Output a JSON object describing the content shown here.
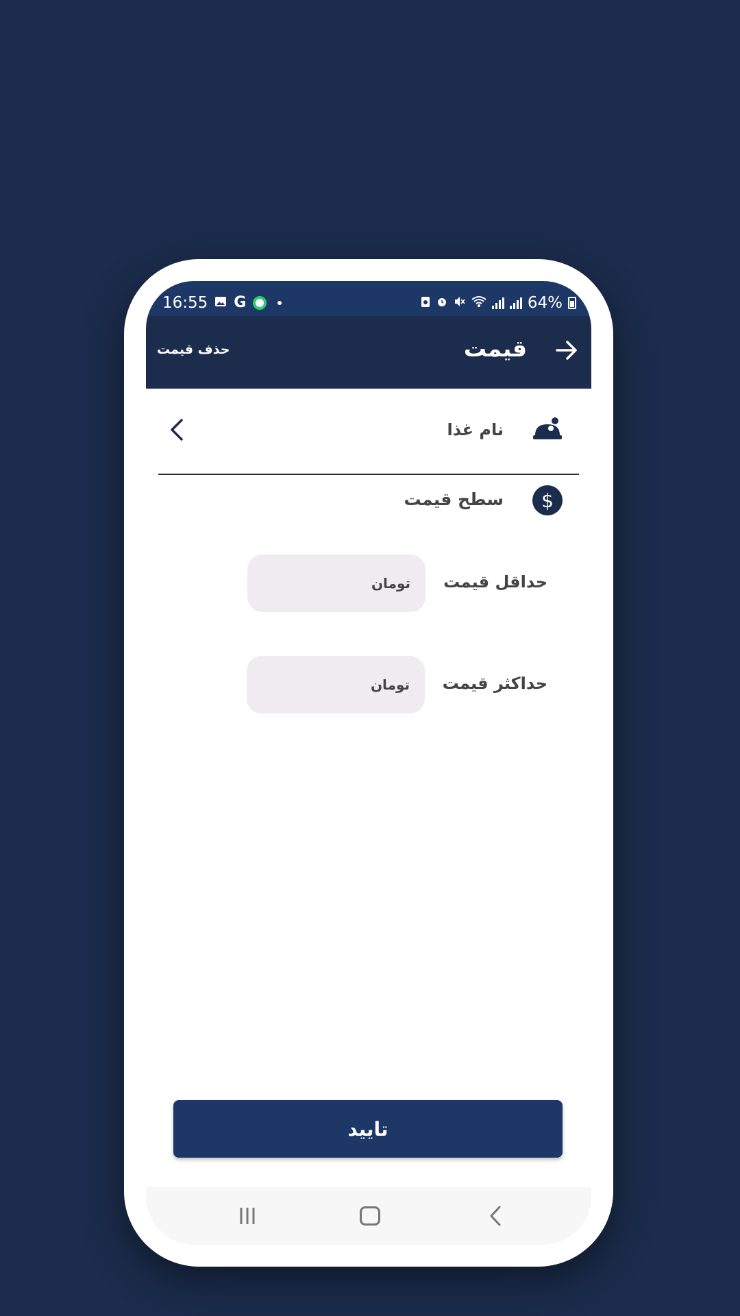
{
  "status_bar": {
    "time": "16:55",
    "g_label": "G",
    "battery": "64%"
  },
  "app_bar": {
    "title": "قیمت",
    "delete_label": "حذف قیمت"
  },
  "food_row": {
    "label": "نام غذا"
  },
  "price_level": {
    "label": "سطح قیمت",
    "icon_glyph": "$"
  },
  "min_price": {
    "label": "حداقل قیمت",
    "unit": "تومان"
  },
  "max_price": {
    "label": "حداکثر قیمت",
    "unit": "تومان"
  },
  "confirm": {
    "label": "تایید"
  },
  "colors": {
    "background": "#1b2c4c",
    "app_bar": "#1b2c4c",
    "status_bar": "#1d3867",
    "button": "#1d3867",
    "input_bg": "#efebee"
  },
  "icons": [
    "arrow-right-icon",
    "chevron-left-icon",
    "food-tray-icon",
    "dollar-icon",
    "recents-icon",
    "home-icon",
    "back-icon"
  ]
}
